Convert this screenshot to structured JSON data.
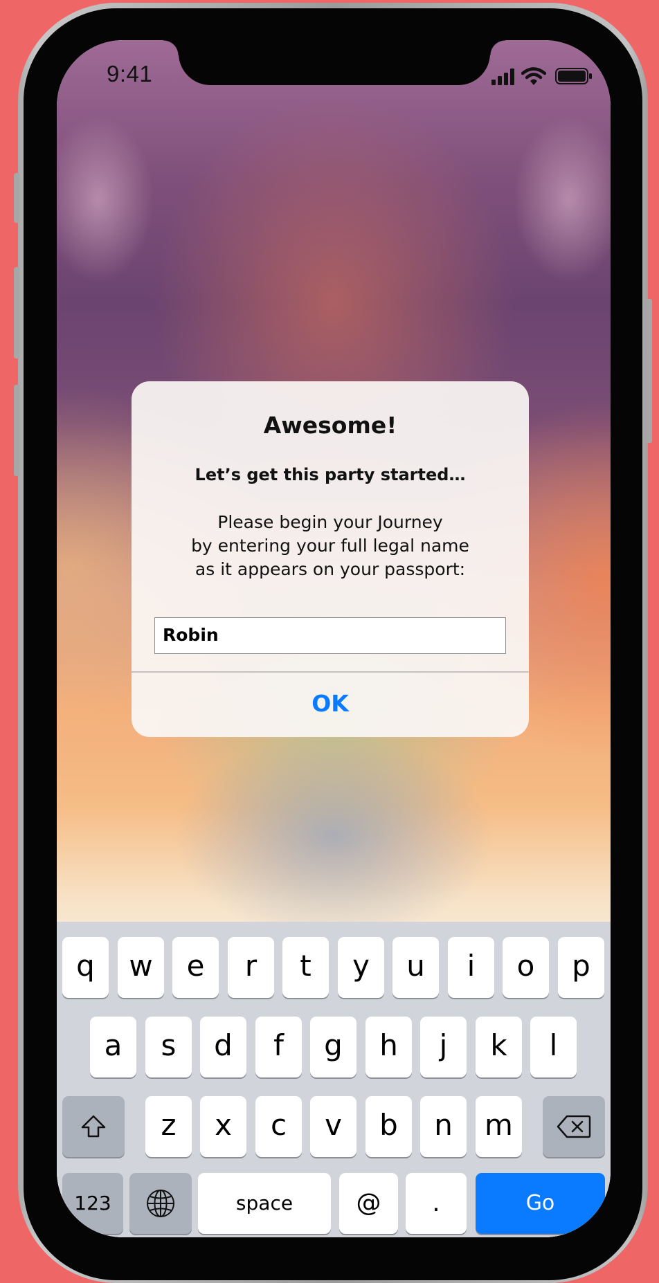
{
  "status_bar": {
    "time": "9:41"
  },
  "alert": {
    "title": "Awesome!",
    "subtitle": "Let’s get this party started…",
    "message_lines": [
      "Please begin your Journey",
      "by entering your full legal name",
      "as it appears on your passport:"
    ],
    "input_value": "Robin",
    "ok_label": "OK",
    "ok_color": "#0a7aff"
  },
  "keyboard": {
    "row1": [
      "q",
      "w",
      "e",
      "r",
      "t",
      "y",
      "u",
      "i",
      "o",
      "p"
    ],
    "row2": [
      "a",
      "s",
      "d",
      "f",
      "g",
      "h",
      "j",
      "k",
      "l"
    ],
    "row3": [
      "z",
      "x",
      "c",
      "v",
      "b",
      "n",
      "m"
    ],
    "shift_icon": "shift-icon",
    "delete_icon": "delete-icon",
    "numbers_label": "123",
    "globe_icon": "globe-icon",
    "space_label": "space",
    "at_label": "@",
    "period_label": ".",
    "go_label": "Go",
    "go_color": "#0a7aff"
  }
}
